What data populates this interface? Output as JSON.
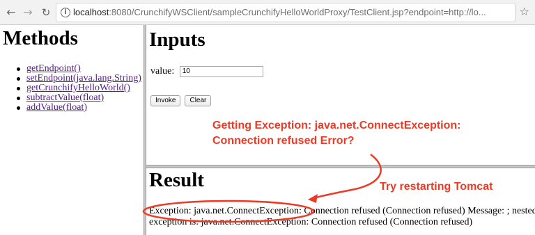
{
  "browser": {
    "back_icon": "←",
    "forward_icon": "→",
    "reload_icon": "↻",
    "info_icon": "i",
    "star_icon": "☆",
    "url_host": "localhost",
    "url_rest": ":8080/CrunchifyWSClient/sampleCrunchifyHelloWorldProxy/TestClient.jsp?endpoint=http://lo..."
  },
  "methods": {
    "title": "Methods",
    "items": [
      "getEndpoint()",
      "setEndpoint(java.lang.String)",
      "getCrunchifyHelloWorld()",
      "subtractValue(float)",
      "addValue(float)"
    ]
  },
  "inputs": {
    "title": "Inputs",
    "value_label": "value:",
    "value_input": "10",
    "invoke_label": "Invoke",
    "clear_label": "Clear"
  },
  "annotations": {
    "exception_line1": "Getting Exception: java.net.ConnectException:",
    "exception_line2": "Connection refused Error?",
    "restart": "Try restarting Tomcat",
    "color": "#ee3a24"
  },
  "result": {
    "title": "Result",
    "line1": "Exception: java.net.ConnectException: Connection refused (Connection refused) Message: ; nested",
    "line2": "exception is: java.net.ConnectException: Connection refused (Connection refused)"
  }
}
